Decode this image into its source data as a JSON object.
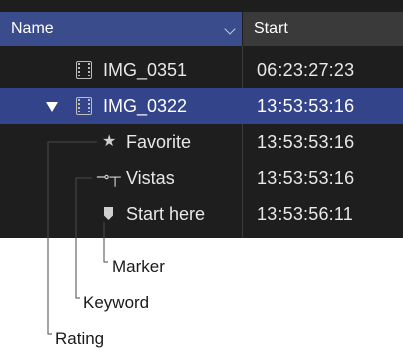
{
  "header": {
    "name_label": "Name",
    "start_label": "Start"
  },
  "rows": [
    {
      "name": "IMG_0351",
      "time": "06:23:27:23",
      "icon": "filmstrip-icon"
    },
    {
      "name": "IMG_0322",
      "time": "13:53:53:16",
      "icon": "filmstrip-icon",
      "expanded": true
    },
    {
      "name": "Favorite",
      "time": "13:53:53:16",
      "icon": "star-icon"
    },
    {
      "name": "Vistas",
      "time": "13:53:53:16",
      "icon": "key-icon"
    },
    {
      "name": "Start here",
      "time": "13:53:56:11",
      "icon": "marker-icon"
    }
  ],
  "icons": {
    "star": "★",
    "key": "⊸┬"
  },
  "callouts": {
    "marker": "Marker",
    "keyword": "Keyword",
    "rating": "Rating"
  },
  "colors": {
    "browser_bg": "#1e1e1e",
    "header_name_bg": "#3a4c8c",
    "header_start_bg": "#3a3a3a",
    "selected_row_bg": "#34448a"
  }
}
